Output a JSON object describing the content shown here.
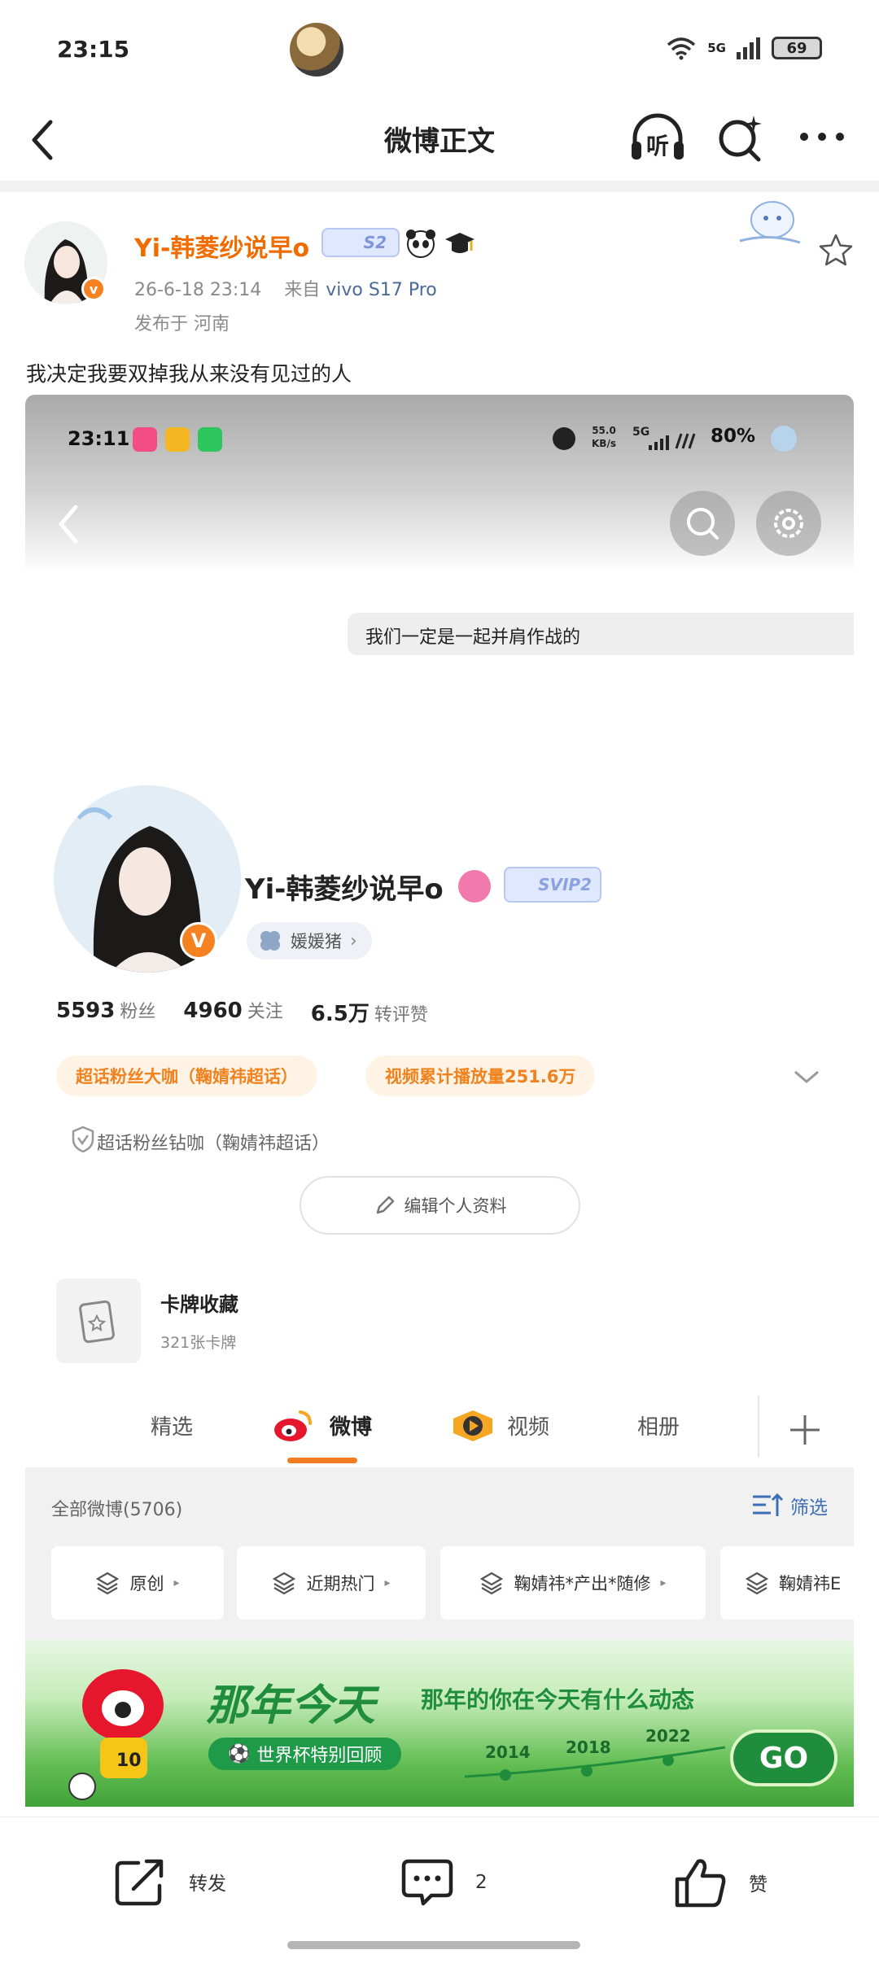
{
  "status_bar": {
    "time": "23:15",
    "network": "5G",
    "battery": "69"
  },
  "header": {
    "title": "微博正文",
    "listen_label": "听"
  },
  "post": {
    "username": "Yi-韩菱纱说早o",
    "level_badge": "S2",
    "date": "26-6-18 23:14",
    "from_label": "来自",
    "device": "vivo S17 Pro",
    "location": "发布于 河南",
    "text": "我决定我要双掉我从来没有见过的人"
  },
  "screenshot": {
    "status": {
      "time": "23:11",
      "speed_value": "55.0",
      "speed_unit": "KB/s",
      "network": "5G",
      "battery": "80%"
    },
    "message_bubble": "我们一定是一起并肩作战的",
    "profile": {
      "name": "Yi-韩菱纱说早o",
      "svip": "SVIP2",
      "nickname": "媛媛猪",
      "stats": [
        {
          "value": "5593",
          "unit": "粉丝"
        },
        {
          "value": "4960",
          "unit": "关注"
        },
        {
          "value": "6.5万",
          "unit": "转评赞"
        }
      ],
      "tags": [
        "超话粉丝大咖（鞠婧祎超话）",
        "视频累计播放量251.6万"
      ],
      "fan_line": "超话粉丝钻咖（鞠婧祎超话）",
      "edit_button": "编辑个人资料",
      "card_title": "卡牌收藏",
      "card_sub": "321张卡牌"
    },
    "tabs": [
      "精选",
      "微博",
      "视频",
      "相册"
    ],
    "active_tab": "微博",
    "all_weibo": "全部微博(5706)",
    "filter": "筛选",
    "chips": [
      "原创",
      "近期热门",
      "鞠婧祎*产出*随修",
      "鞠婧祎E"
    ],
    "banner": {
      "title": "那年今天",
      "subtitle": "那年的你在今天有什么动态",
      "pill": "世界杯特别回顾",
      "years": [
        "2014",
        "2018",
        "2022"
      ],
      "go": "GO",
      "jersey_number": "10"
    }
  },
  "actions": {
    "repost": "转发",
    "comments": "2",
    "like": "赞"
  }
}
